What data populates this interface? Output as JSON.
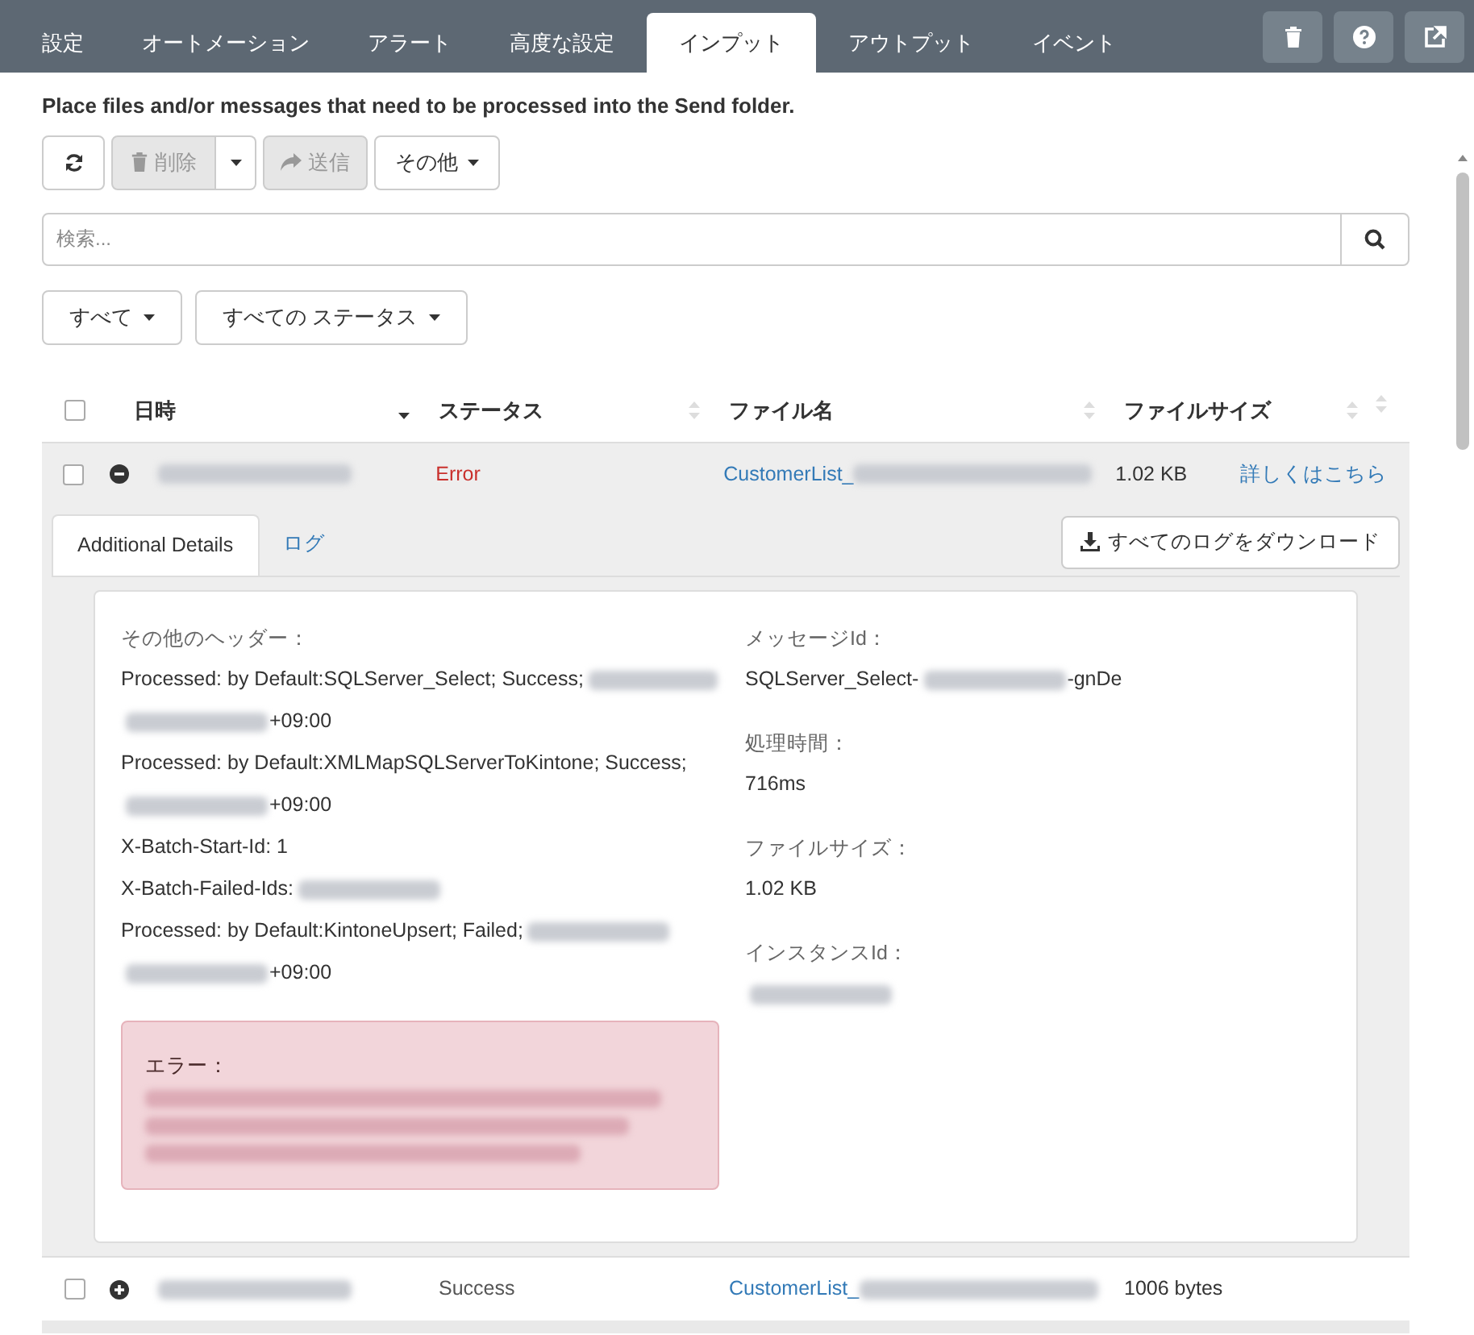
{
  "tabs": [
    {
      "label": "設定",
      "selected": false
    },
    {
      "label": "オートメーション",
      "selected": false
    },
    {
      "label": "アラート",
      "selected": false
    },
    {
      "label": "高度な設定",
      "selected": false
    },
    {
      "label": "インプット",
      "selected": true
    },
    {
      "label": "アウトプット",
      "selected": false
    },
    {
      "label": "イベント",
      "selected": false
    }
  ],
  "instructions": "Place files and/or messages that need to be processed into the  Send folder.",
  "toolbar": {
    "delete": {
      "label": "削除",
      "disabled": true
    },
    "send": {
      "label": "送信",
      "disabled": true
    },
    "other": {
      "label": "その他"
    }
  },
  "search": {
    "placeholder": "検索..."
  },
  "filters": [
    "すべて",
    "すべての ステータス"
  ],
  "table": {
    "select_all": {
      "checked": false
    },
    "columns": [
      {
        "label": "日時",
        "sorted": true
      },
      {
        "label": "ステータス",
        "sorted": false
      },
      {
        "label": "ファイル名",
        "sorted": false
      },
      {
        "label": "ファイルサイズ",
        "sorted": false
      }
    ],
    "rows": [
      {
        "checked": false,
        "expanded": true,
        "status": "Error",
        "kind": "error",
        "file": "CustomerList_",
        "size": "1.02 KB",
        "link": "詳しくはこちら"
      },
      {
        "checked": false,
        "expanded": false,
        "status": "Success",
        "kind": "success",
        "file": "CustomerList_",
        "size": "1006 bytes"
      }
    ]
  },
  "details": {
    "tabs": [
      {
        "label": "Additional Details",
        "selected": true
      },
      {
        "label": "ログ",
        "selected": false
      }
    ],
    "download": "すべてのログをダウンロード",
    "headers_label": "その他のヘッダー：",
    "header_lines": [
      [
        {
          "kind": "text",
          "text": "Processed: by Default:SQLServer_Select; Success;"
        },
        {
          "kind": "blur"
        }
      ],
      [
        {
          "kind": "blur"
        },
        {
          "kind": "text",
          "text": "+09:00"
        }
      ],
      [
        {
          "kind": "text",
          "text": "Processed: by Default:XMLMapSQLServerToKintone; Success;"
        }
      ],
      [
        {
          "kind": "blur"
        },
        {
          "kind": "text",
          "text": "+09:00"
        }
      ],
      [
        {
          "kind": "text",
          "text": "X-Batch-Start-Id: 1"
        }
      ],
      [
        {
          "kind": "text",
          "text": "X-Batch-Failed-Ids:"
        },
        {
          "kind": "blur"
        }
      ],
      [
        {
          "kind": "text",
          "text": "Processed: by Default:KintoneUpsert; Failed;"
        },
        {
          "kind": "blur"
        }
      ],
      [
        {
          "kind": "blur"
        },
        {
          "kind": "text",
          "text": "+09:00"
        }
      ]
    ],
    "fields": [
      {
        "label": "メッセージId：",
        "value": [
          {
            "kind": "text",
            "text": "SQLServer_Select-"
          },
          {
            "kind": "blur"
          },
          {
            "kind": "text",
            "text": "-gnDe"
          }
        ]
      },
      {
        "label": "処理時間：",
        "value": [
          {
            "kind": "text",
            "text": "716ms"
          }
        ]
      },
      {
        "label": "ファイルサイズ：",
        "value": [
          {
            "kind": "text",
            "text": "1.02 KB"
          }
        ]
      },
      {
        "label": "インスタンスId：",
        "value": [
          {
            "kind": "blur"
          }
        ]
      }
    ],
    "error": {
      "label": "エラー："
    }
  }
}
